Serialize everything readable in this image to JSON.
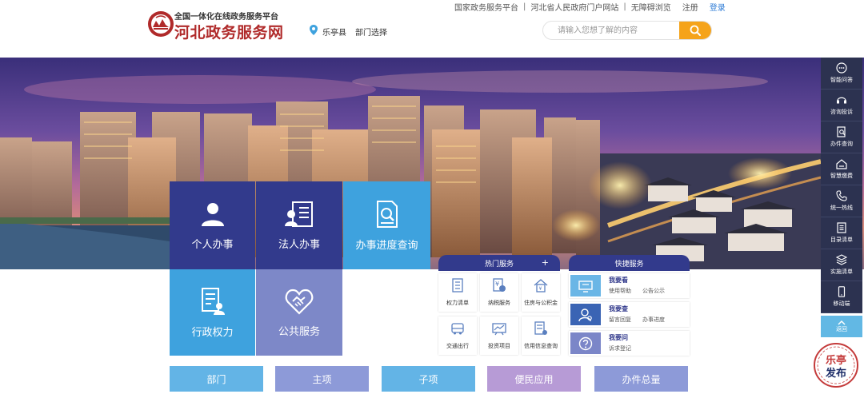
{
  "header": {
    "logo_subtitle": "全国一体化在线政务服务平台",
    "logo_title": "河北政务服务网",
    "location": "乐亭县",
    "department_select": "部门选择",
    "top_links": [
      "国家政务服务平台",
      "河北省人民政府门户网站",
      "无障碍浏览"
    ],
    "separator": "|",
    "register": "注册",
    "login": "登录",
    "search_placeholder": "请输入您想了解的内容"
  },
  "tiles": {
    "personal": "个人办事",
    "legal": "法人办事",
    "progress": "办事进度查询",
    "admin_power": "行政权力",
    "public_service": "公共服务"
  },
  "hot_services": {
    "title": "热门服务",
    "more": "+",
    "items": [
      "权力清单",
      "纳税服务",
      "住房与公积金",
      "交通出行",
      "投资项目",
      "信用信息查询"
    ]
  },
  "quick_services": {
    "title": "快捷服务",
    "rows": [
      {
        "title": "我要看",
        "sub1": "使用帮助",
        "sub2": "公告公示"
      },
      {
        "title": "我要查",
        "sub1": "留言回复",
        "sub2": "办事进度"
      },
      {
        "title": "我要问",
        "sub1": "诉求登记",
        "sub2": ""
      }
    ]
  },
  "bottom_tabs": [
    "部门",
    "主项",
    "子项",
    "便民应用",
    "办件总量"
  ],
  "sidebar": {
    "items": [
      "智能问答",
      "咨询投诉",
      "办件查询",
      "智慧缴费",
      "统一热线",
      "目录清单",
      "实施清单",
      "移动端"
    ],
    "back_top": "返回"
  },
  "watermark": {
    "line1": "乐亭",
    "line2": "发布"
  },
  "colors": {
    "brand_red": "#b02a2a",
    "navy": "#323a8c",
    "sky": "#3ea2de",
    "lavender": "#7d88c8",
    "search_orange": "#f5a31a",
    "sidebar_bg": "#2c3250",
    "link_blue": "#2d7bd6"
  }
}
